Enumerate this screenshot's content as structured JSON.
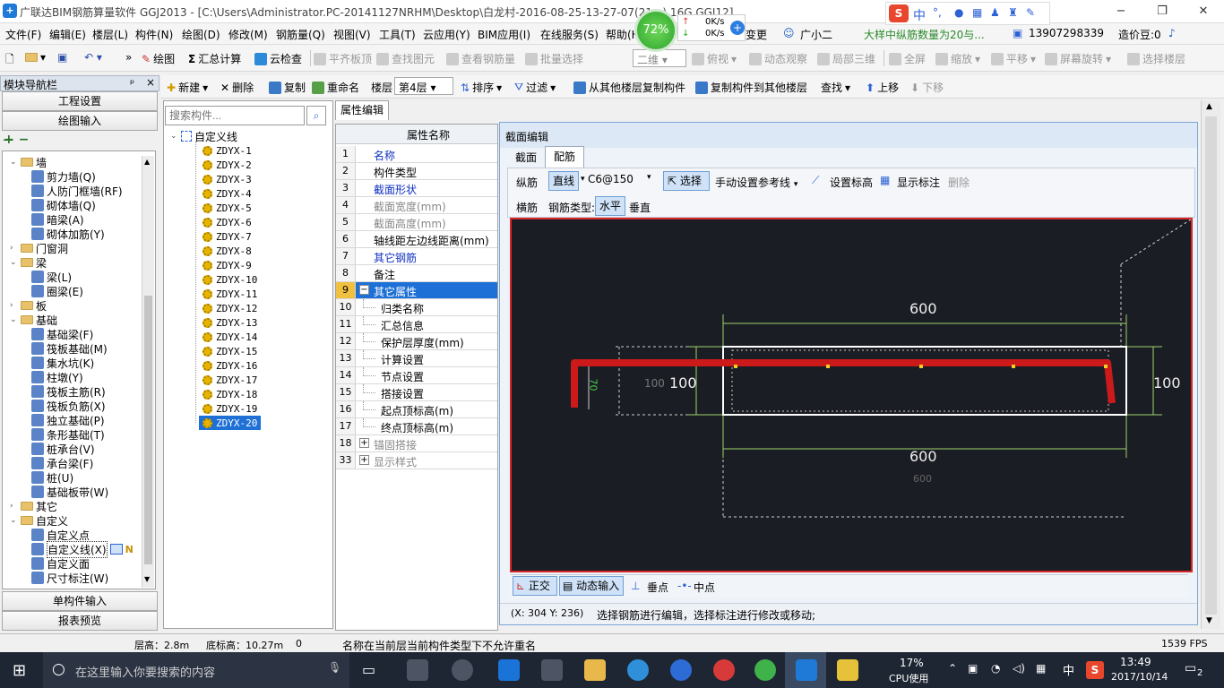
{
  "window": {
    "title": "广联达BIM钢筋算量软件 GGJ2013 - [C:\\Users\\Administrator.PC-20141127NRHM\\Desktop\\白龙村-2016-08-25-13-27-07(21...) 16G.GGJ12]",
    "minimize": "−",
    "restore": "❐",
    "close": "✕"
  },
  "overlay": {
    "percent": "72%",
    "up_speed": "0K/s",
    "down_speed": "0K/s",
    "ime_label": "中",
    "punct": "°,"
  },
  "menu": [
    "文件(F)",
    "编辑(E)",
    "楼层(L)",
    "构件(N)",
    "绘图(D)",
    "修改(M)",
    "钢筋量(Q)",
    "视图(V)",
    "工具(T)",
    "云应用(Y)",
    "BIM应用(I)",
    "在线服务(S)",
    "帮助(H)"
  ],
  "menu_right": {
    "change": "变更",
    "assistant": "广小二",
    "notice": "大样中纵筋数量为20与...",
    "phone": "13907298339",
    "points": "造价豆:0"
  },
  "toolbar1": {
    "draw": "绘图",
    "summary": "汇总计算",
    "cloud_check": "云检查",
    "level_board": "平齐板顶",
    "find_elem": "查找图元",
    "view_rebar": "查看钢筋量",
    "batch_select": "批量选择",
    "view_mode": "二维",
    "top_view": "俯视",
    "dynamic_view": "动态观察",
    "local_3d": "局部三维",
    "fullscreen": "全屏",
    "zoom": "缩放",
    "pan": "平移",
    "rotate": "屏幕旋转",
    "select_floor": "选择楼层"
  },
  "toolbar2": {
    "new": "新建",
    "delete": "删除",
    "copy": "复制",
    "rename": "重命名",
    "floor_label": "楼层",
    "floor_value": "第4层",
    "sort": "排序",
    "filter": "过滤",
    "copy_from": "从其他楼层复制构件",
    "copy_to": "复制构件到其他楼层",
    "find": "查找",
    "up": "上移",
    "down": "下移"
  },
  "nav": {
    "header": "模块导航栏",
    "pin": "ᵖ",
    "close": "×",
    "btn_project": "工程设置",
    "btn_draw": "绘图输入",
    "btn_single": "单构件输入",
    "btn_report": "报表预览",
    "tree": [
      {
        "label": "墙",
        "type": "folder",
        "indent": 0,
        "exp": "⌄"
      },
      {
        "label": "剪力墙(Q)",
        "type": "item",
        "indent": 1
      },
      {
        "label": "人防门框墙(RF)",
        "type": "item",
        "indent": 1
      },
      {
        "label": "砌体墙(Q)",
        "type": "item",
        "indent": 1
      },
      {
        "label": "暗梁(A)",
        "type": "item",
        "indent": 1
      },
      {
        "label": "砌体加筋(Y)",
        "type": "item",
        "indent": 1
      },
      {
        "label": "门窗洞",
        "type": "folder",
        "indent": 0,
        "exp": "›"
      },
      {
        "label": "梁",
        "type": "folder",
        "indent": 0,
        "exp": "⌄"
      },
      {
        "label": "梁(L)",
        "type": "item",
        "indent": 1
      },
      {
        "label": "圈梁(E)",
        "type": "item",
        "indent": 1
      },
      {
        "label": "板",
        "type": "folder",
        "indent": 0,
        "exp": "›"
      },
      {
        "label": "基础",
        "type": "folder",
        "indent": 0,
        "exp": "⌄"
      },
      {
        "label": "基础梁(F)",
        "type": "item",
        "indent": 1
      },
      {
        "label": "筏板基础(M)",
        "type": "item",
        "indent": 1
      },
      {
        "label": "集水坑(K)",
        "type": "item",
        "indent": 1
      },
      {
        "label": "柱墩(Y)",
        "type": "item",
        "indent": 1
      },
      {
        "label": "筏板主筋(R)",
        "type": "item",
        "indent": 1
      },
      {
        "label": "筏板负筋(X)",
        "type": "item",
        "indent": 1
      },
      {
        "label": "独立基础(P)",
        "type": "item",
        "indent": 1
      },
      {
        "label": "条形基础(T)",
        "type": "item",
        "indent": 1
      },
      {
        "label": "桩承台(V)",
        "type": "item",
        "indent": 1
      },
      {
        "label": "承台梁(F)",
        "type": "item",
        "indent": 1
      },
      {
        "label": "桩(U)",
        "type": "item",
        "indent": 1
      },
      {
        "label": "基础板带(W)",
        "type": "item",
        "indent": 1
      },
      {
        "label": "其它",
        "type": "folder",
        "indent": 0,
        "exp": "›"
      },
      {
        "label": "自定义",
        "type": "folder",
        "indent": 0,
        "exp": "⌄"
      },
      {
        "label": "自定义点",
        "type": "item",
        "indent": 1
      },
      {
        "label": "自定义线(X)",
        "type": "item",
        "indent": 1,
        "selected": true
      },
      {
        "label": "自定义面",
        "type": "item",
        "indent": 1
      },
      {
        "label": "尺寸标注(W)",
        "type": "item",
        "indent": 1
      }
    ]
  },
  "components": {
    "search_placeholder": "搜索构件...",
    "root": "自定义线",
    "items": [
      "ZDYX-1",
      "ZDYX-2",
      "ZDYX-3",
      "ZDYX-4",
      "ZDYX-5",
      "ZDYX-6",
      "ZDYX-7",
      "ZDYX-8",
      "ZDYX-9",
      "ZDYX-10",
      "ZDYX-11",
      "ZDYX-12",
      "ZDYX-13",
      "ZDYX-14",
      "ZDYX-15",
      "ZDYX-16",
      "ZDYX-17",
      "ZDYX-18",
      "ZDYX-19",
      "ZDYX-20"
    ],
    "selected": "ZDYX-20"
  },
  "properties": {
    "tab": "属性编辑",
    "header": "属性名称",
    "rows": [
      {
        "num": "1",
        "name": "名称",
        "style": "blue"
      },
      {
        "num": "2",
        "name": "构件类型",
        "style": ""
      },
      {
        "num": "3",
        "name": "截面形状",
        "style": "blue"
      },
      {
        "num": "4",
        "name": "截面宽度(mm)",
        "style": "gray"
      },
      {
        "num": "5",
        "name": "截面高度(mm)",
        "style": "gray"
      },
      {
        "num": "6",
        "name": "轴线距左边线距离(mm)",
        "style": ""
      },
      {
        "num": "7",
        "name": "其它钢筋",
        "style": "blue"
      },
      {
        "num": "8",
        "name": "备注",
        "style": ""
      },
      {
        "num": "9",
        "name": "其它属性",
        "style": "sel",
        "exp": "−"
      },
      {
        "num": "10",
        "name": "归类名称",
        "style": "",
        "indent": true
      },
      {
        "num": "11",
        "name": "汇总信息",
        "style": "",
        "indent": true
      },
      {
        "num": "12",
        "name": "保护层厚度(mm)",
        "style": "",
        "indent": true
      },
      {
        "num": "13",
        "name": "计算设置",
        "style": "",
        "indent": true
      },
      {
        "num": "14",
        "name": "节点设置",
        "style": "",
        "indent": true
      },
      {
        "num": "15",
        "name": "搭接设置",
        "style": "",
        "indent": true
      },
      {
        "num": "16",
        "name": "起点顶标高(m)",
        "style": "",
        "indent": true
      },
      {
        "num": "17",
        "name": "终点顶标高(m)",
        "style": "",
        "indent": true
      },
      {
        "num": "18",
        "name": "锚固搭接",
        "style": "gray",
        "exp": "+"
      },
      {
        "num": "33",
        "name": "显示样式",
        "style": "gray",
        "exp": "+"
      }
    ]
  },
  "section_editor": {
    "title": "截面编辑",
    "tabs": [
      "截面",
      "配筋"
    ],
    "active_tab": "配筋",
    "row1": {
      "longitudinal": "纵筋",
      "straight": "直线",
      "spec": "C6@150",
      "select": "选择",
      "manual_ref": "手动设置参考线",
      "set_elev": "设置标高",
      "show_dim": "显示标注",
      "delete": "删除"
    },
    "row2": {
      "transverse": "横筋",
      "rebar_type_label": "钢筋类型:",
      "horizontal": "水平",
      "vertical": "垂直"
    },
    "canvas": {
      "dim_top": "600",
      "dim_bottom": "600",
      "dim_bottom_faint": "600",
      "dim_left": "100",
      "dim_left_faint": "100",
      "dim_right": "100",
      "dim_hook": "70"
    },
    "bottom": {
      "ortho": "正交",
      "dynamic_input": "动态输入",
      "perp": "垂点",
      "mid": "中点"
    },
    "coords": "(X: 304 Y: 236)",
    "hint": "选择钢筋进行编辑，选择标注进行修改或移动;"
  },
  "status": {
    "floor_height": "层高：2.8m",
    "bottom_elev": "底标高：10.27m",
    "zero": "0",
    "message": "名称在当前层当前构件类型下不允许重名",
    "fps": "1539 FPS"
  },
  "taskbar": {
    "search_placeholder": "在这里输入你要搜索的内容",
    "cpu_pct": "17%",
    "cpu_label": "CPU使用",
    "ime": "中",
    "time": "13:49",
    "date": "2017/10/14",
    "notif": "2"
  },
  "colors": {
    "accent": "#1e70d6",
    "rebar": "#d01818",
    "canvas_bg": "#1b1d24",
    "dim_green": "#9ed36a"
  }
}
